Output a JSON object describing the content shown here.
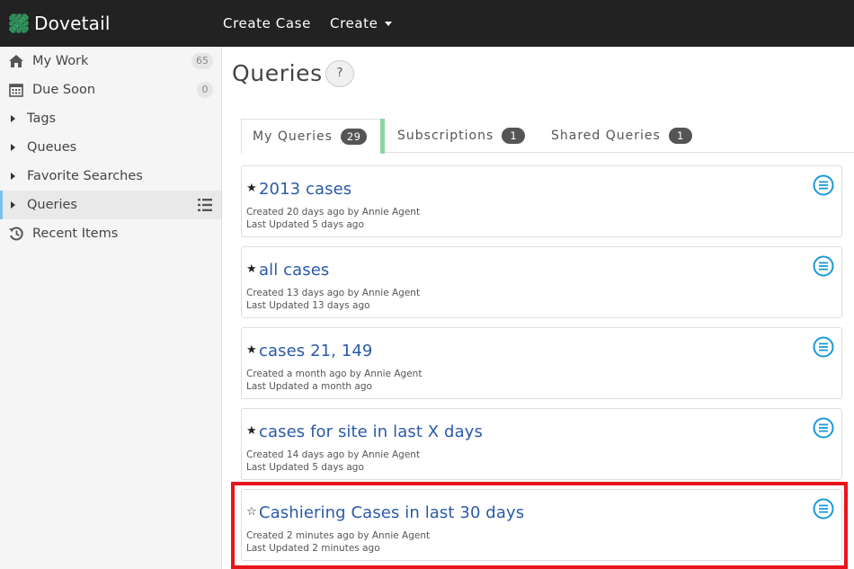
{
  "topbar": {
    "brand": "Dovetail",
    "create_case": "Create Case",
    "create": "Create"
  },
  "sidebar": {
    "items": [
      {
        "label": "My Work",
        "icon": "home-icon",
        "count": "65"
      },
      {
        "label": "Due Soon",
        "icon": "calendar-icon",
        "count": "0"
      },
      {
        "label": "Tags",
        "icon": "caret-right-icon"
      },
      {
        "label": "Queues",
        "icon": "caret-right-icon"
      },
      {
        "label": "Favorite Searches",
        "icon": "caret-right-icon"
      },
      {
        "label": "Queries",
        "icon": "caret-right-icon",
        "active": true
      },
      {
        "label": "Recent Items",
        "icon": "history-icon"
      }
    ]
  },
  "main": {
    "title": "Queries",
    "help": "?",
    "tabs": [
      {
        "label": "My Queries",
        "count": "29",
        "active": true
      },
      {
        "label": "Subscriptions",
        "count": "1"
      },
      {
        "label": "Shared Queries",
        "count": "1"
      }
    ],
    "queries": [
      {
        "star": "★",
        "name": "2013 cases",
        "created": "Created 20 days ago by Annie Agent",
        "updated": "Last Updated 5 days ago"
      },
      {
        "star": "★",
        "name": "all cases",
        "created": "Created 13 days ago by Annie Agent",
        "updated": "Last Updated 13 days ago"
      },
      {
        "star": "★",
        "name": "cases 21, 149",
        "created": "Created a month ago by Annie Agent",
        "updated": "Last Updated a month ago"
      },
      {
        "star": "★",
        "name": "cases for site in last X days",
        "created": "Created 14 days ago by Annie Agent",
        "updated": "Last Updated 5 days ago"
      },
      {
        "star": "☆",
        "name": "Cashiering Cases in last 30 days",
        "created": "Created 2 minutes ago by Annie Agent",
        "updated": "Last Updated 2 minutes ago"
      }
    ]
  },
  "colors": {
    "topbar": "#222222",
    "link": "#2a5aa8",
    "accent": "#1a9ad6",
    "highlight": "#e8141b",
    "brand_green": "#3fa66a"
  }
}
